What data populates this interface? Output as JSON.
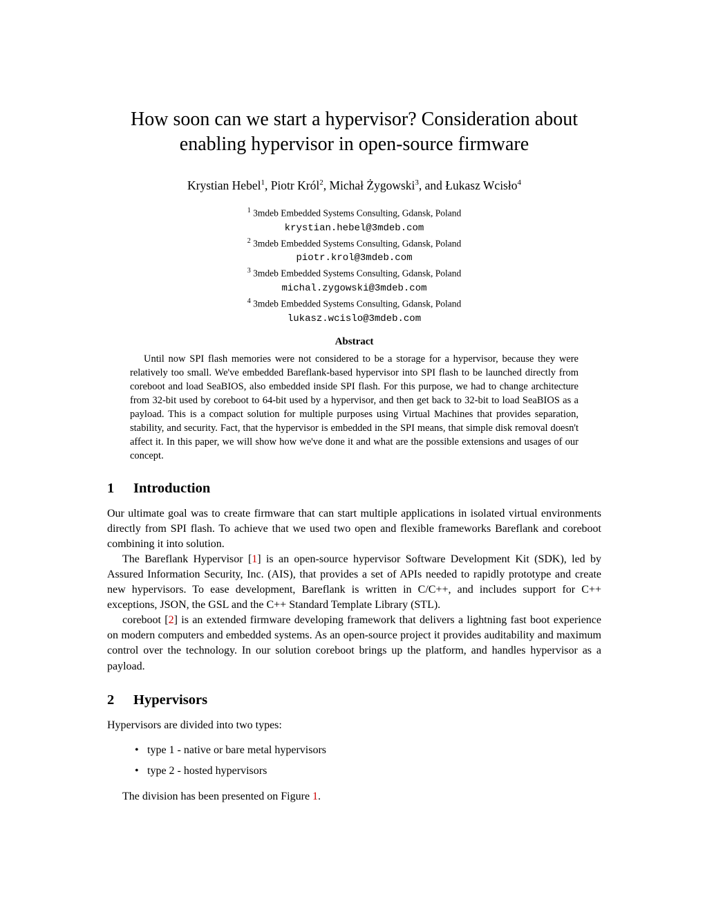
{
  "title": "How soon can we start a hypervisor? Consideration about enabling hypervisor in open-source firmware",
  "authors_line": {
    "a1_name": "Krystian Hebel",
    "a1_sup": "1",
    "sep1": ", ",
    "a2_name": "Piotr Król",
    "a2_sup": "2",
    "sep2": ", ",
    "a3_name": "Michał Żygowski",
    "a3_sup": "3",
    "sep3": ", and ",
    "a4_name": "Łukasz Wcisło",
    "a4_sup": "4"
  },
  "affiliations": {
    "a1_num": "1",
    "a1_text": " 3mdeb Embedded Systems Consulting, Gdansk, Poland",
    "a1_email": "krystian.hebel@3mdeb.com",
    "a2_num": "2",
    "a2_text": " 3mdeb Embedded Systems Consulting, Gdansk, Poland",
    "a2_email": "piotr.krol@3mdeb.com",
    "a3_num": "3",
    "a3_text": " 3mdeb Embedded Systems Consulting, Gdansk, Poland",
    "a3_email": "michal.zygowski@3mdeb.com",
    "a4_num": "4",
    "a4_text": " 3mdeb Embedded Systems Consulting, Gdansk, Poland",
    "a4_email": "lukasz.wcislo@3mdeb.com"
  },
  "abstract_title": "Abstract",
  "abstract_text": "Until now SPI flash memories were not considered to be a storage for a hypervisor, because they were relatively too small. We've embedded Bareflank-based hypervisor into SPI flash to be launched directly from coreboot and load SeaBIOS, also embedded inside SPI flash. For this purpose, we had to change architecture from 32-bit used by coreboot to 64-bit used by a hypervisor, and then get back to 32-bit to load SeaBIOS as a payload. This is a compact solution for multiple purposes using Virtual Machines that provides separation, stability, and security. Fact, that the hypervisor is embedded in the SPI means, that simple disk removal doesn't affect it. In this paper, we will show how we've done it and what are the possible extensions and usages of our concept.",
  "sections": {
    "s1_num": "1",
    "s1_title": "Introduction",
    "s1_p1": "Our ultimate goal was to create firmware that can start multiple applications in isolated virtual environments directly from SPI flash. To achieve that we used two open and flexible frameworks Bareflank and coreboot combining it into solution.",
    "s1_p2_a": "The Bareflank Hypervisor [",
    "s1_p2_cite": "1",
    "s1_p2_b": "] is an open-source hypervisor Software Development Kit (SDK), led by Assured Information Security, Inc. (AIS), that provides a set of APIs needed to rapidly prototype and create new hypervisors. To ease development, Bareflank is written in C/C++, and includes support for C++ exceptions, JSON, the GSL and the C++ Standard Template Library (STL).",
    "s1_p3_a": "coreboot [",
    "s1_p3_cite": "2",
    "s1_p3_b": "] is an extended firmware developing framework that delivers a lightning fast boot experience on modern computers and embedded systems. As an open-source project it provides auditability and maximum control over the technology. In our solution coreboot brings up the platform, and handles hypervisor as a payload.",
    "s2_num": "2",
    "s2_title": "Hypervisors",
    "s2_p1": "Hypervisors are divided into two types:",
    "s2_bullet1": "type 1 - native or bare metal hypervisors",
    "s2_bullet2": "type 2 - hosted hypervisors",
    "s2_p2_a": "The division has been presented on Figure ",
    "s2_p2_cite": "1",
    "s2_p2_b": "."
  }
}
